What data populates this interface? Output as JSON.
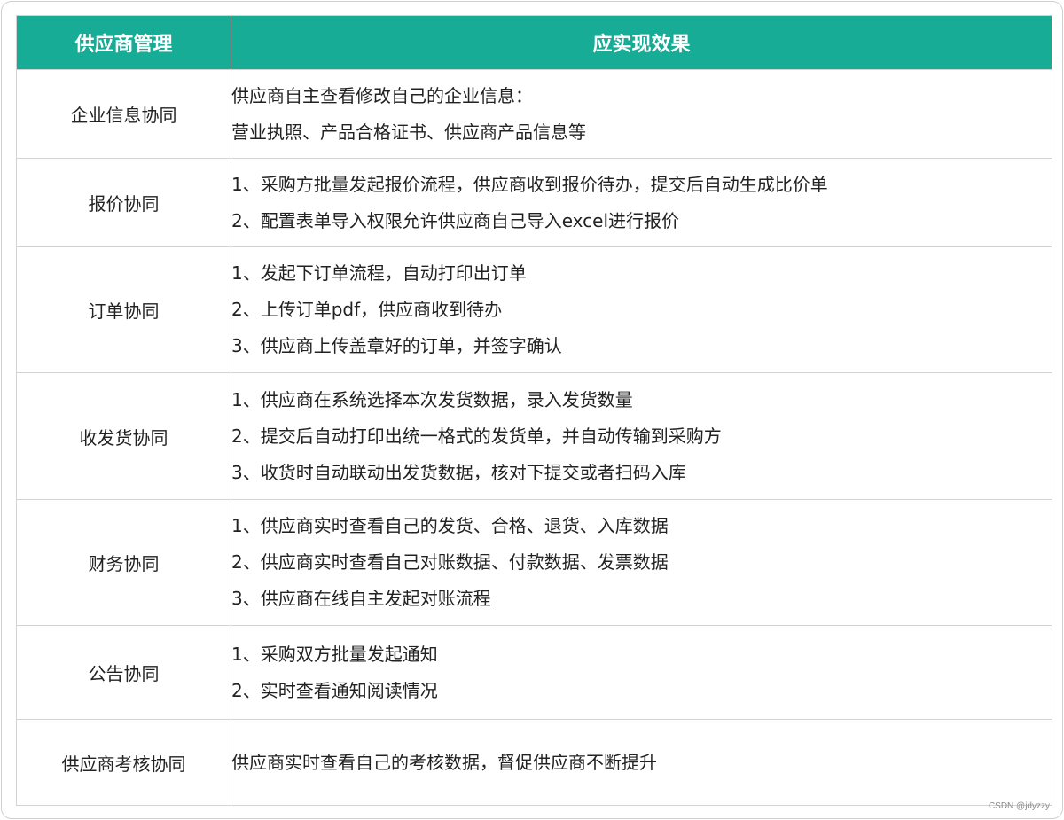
{
  "table": {
    "headers": [
      "供应商管理",
      "应实现效果"
    ],
    "rows": [
      {
        "module": "企业信息协同",
        "effects": [
          "供应商自主查看修改自己的企业信息：",
          "营业执照、产品合格证书、供应商产品信息等"
        ]
      },
      {
        "module": "报价协同",
        "effects": [
          "1、采购方批量发起报价流程，供应商收到报价待办，提交后自动生成比价单",
          "2、配置表单导入权限允许供应商自己导入excel进行报价"
        ]
      },
      {
        "module": "订单协同",
        "effects": [
          "1、发起下订单流程，自动打印出订单",
          "2、上传订单pdf，供应商收到待办",
          "3、供应商上传盖章好的订单，并签字确认"
        ]
      },
      {
        "module": "收发货协同",
        "effects": [
          "1、供应商在系统选择本次发货数据，录入发货数量",
          "2、提交后自动打印出统一格式的发货单，并自动传输到采购方",
          "3、收货时自动联动出发货数据，核对下提交或者扫码入库"
        ]
      },
      {
        "module": "财务协同",
        "effects": [
          "1、供应商实时查看自己的发货、合格、退货、入库数据",
          "2、供应商实时查看自己对账数据、付款数据、发票数据",
          "3、供应商在线自主发起对账流程"
        ]
      },
      {
        "module": "公告协同",
        "effects": [
          "1、采购双方批量发起通知",
          "2、实时查看通知阅读情况"
        ]
      },
      {
        "module": "供应商考核协同",
        "effects": [
          "供应商实时查看自己的考核数据，督促供应商不断提升"
        ]
      }
    ]
  },
  "watermark": "CSDN @jdyzzy",
  "colors": {
    "header_bg": "#17ac96",
    "header_text": "#ffffff",
    "border": "#d3d3d3",
    "body_text": "#222222"
  }
}
